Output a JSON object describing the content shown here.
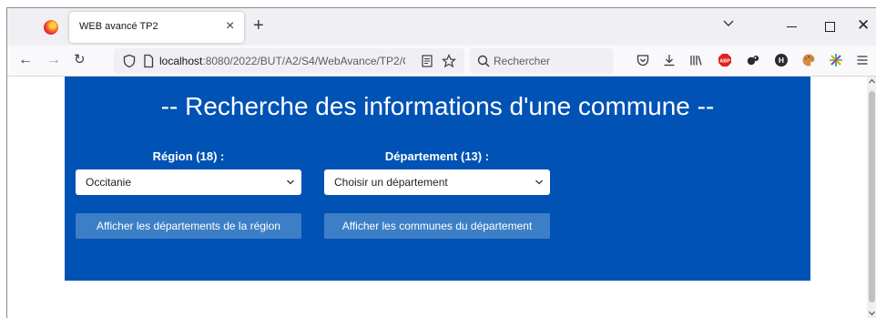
{
  "browser": {
    "tab_title": "WEB avancé TP2",
    "url_host": "localhost",
    "url_path": ":8080/2022/BUT/A2/S4/WebAvance/TP2/Co",
    "search_placeholder": "Rechercher",
    "icons": [
      "back-arrow-icon",
      "forward-arrow-icon",
      "reload-icon",
      "shield-icon",
      "page-icon",
      "reader-view-icon",
      "bookmark-star-icon",
      "search-icon",
      "pocket-icon",
      "download-icon",
      "library-icon",
      "adblock-icon",
      "extension-icon",
      "extension-h-icon",
      "palette-icon",
      "sparkle-icon",
      "menu-icon"
    ],
    "adblock_label": "ABP",
    "extension_h_label": "H"
  },
  "page": {
    "title": "-- Recherche des informations d'une commune --",
    "region": {
      "label": "Région (18) :",
      "selected": "Occitanie",
      "button": "Afficher les départements de la région"
    },
    "departement": {
      "label": "Département (13) :",
      "selected": "Choisir un département",
      "button": "Afficher les communes du département"
    }
  },
  "colors": {
    "panel_background": "#0052b4",
    "button_background": "#3c7fc6",
    "text_on_panel": "#ffffff"
  }
}
